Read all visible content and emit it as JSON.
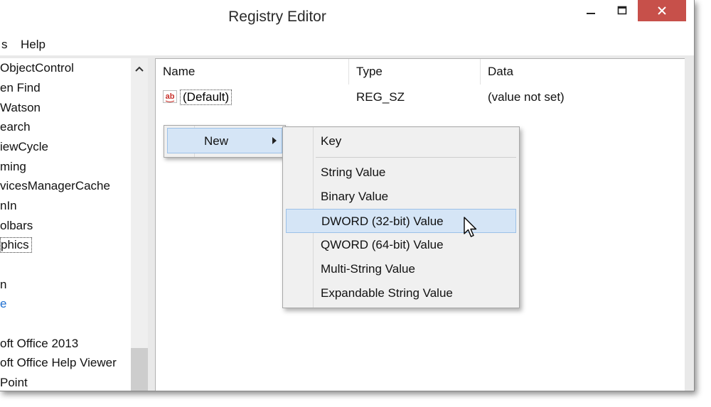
{
  "window": {
    "title": "Registry Editor",
    "minimize_label": "—",
    "maximize_label": "▫",
    "close_label": "✕"
  },
  "menu": {
    "items": [
      "s",
      "Help"
    ]
  },
  "tree": {
    "items": [
      "ObjectControl",
      "en Find",
      "Watson",
      "earch",
      "iewCycle",
      "ming",
      "vicesManagerCache",
      "nIn",
      "olbars",
      "phics",
      "n",
      "e",
      "oft Office 2013",
      "oft Office Help Viewer",
      "Point"
    ],
    "selected_index": 9,
    "highlighted_index": 11,
    "link_color": "#1e6fd0"
  },
  "list": {
    "columns": [
      "Name",
      "Type",
      "Data"
    ],
    "rows": [
      {
        "icon": "string-value-icon",
        "icon_text": "ab",
        "name": "(Default)",
        "type": "REG_SZ",
        "data": "(value not set)"
      }
    ]
  },
  "context_menu": {
    "new_label": "New",
    "submenu_items": [
      "Key",
      "String Value",
      "Binary Value",
      "DWORD (32-bit) Value",
      "QWORD (64-bit) Value",
      "Multi-String Value",
      "Expandable String Value"
    ],
    "highlighted_item": "DWORD (32-bit) Value",
    "highlight_color": "#d5e5f6"
  },
  "colors": {
    "close_button": "#c7504a",
    "icon_red": "#c8302a"
  }
}
